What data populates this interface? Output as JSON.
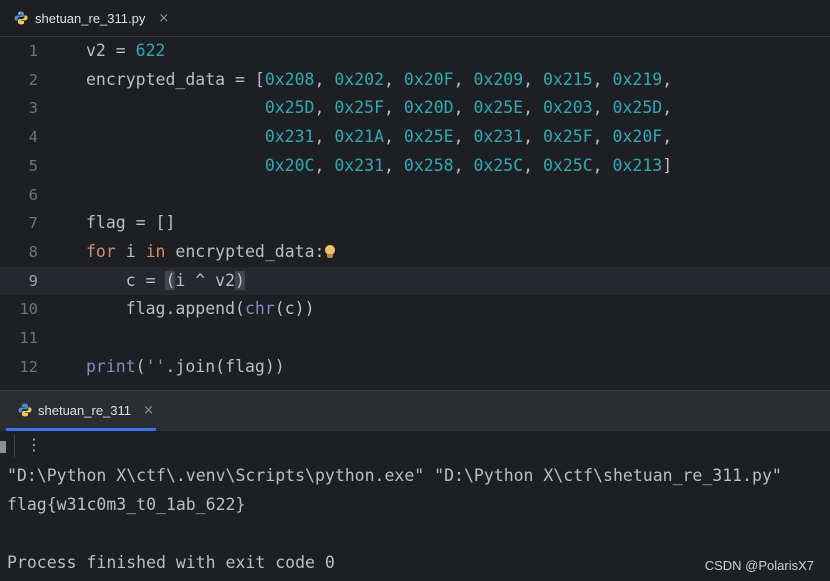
{
  "editor_tab": {
    "label": "shetuan_re_311.py",
    "close": "×",
    "icon": "python-icon"
  },
  "lines": [
    {
      "n": "1",
      "parts": [
        {
          "t": "v2 = ",
          "c": ""
        },
        {
          "t": "622",
          "c": "num"
        }
      ]
    },
    {
      "n": "2",
      "parts": [
        {
          "t": "encrypted_data = [",
          "c": ""
        },
        {
          "t": "0x208",
          "c": "num"
        },
        {
          "t": ", ",
          "c": ""
        },
        {
          "t": "0x202",
          "c": "num"
        },
        {
          "t": ", ",
          "c": ""
        },
        {
          "t": "0x20F",
          "c": "num"
        },
        {
          "t": ", ",
          "c": ""
        },
        {
          "t": "0x209",
          "c": "num"
        },
        {
          "t": ", ",
          "c": ""
        },
        {
          "t": "0x215",
          "c": "num"
        },
        {
          "t": ", ",
          "c": ""
        },
        {
          "t": "0x219",
          "c": "num"
        },
        {
          "t": ",",
          "c": ""
        }
      ]
    },
    {
      "n": "3",
      "parts": [
        {
          "t": "                  ",
          "c": ""
        },
        {
          "t": "0x25D",
          "c": "num"
        },
        {
          "t": ", ",
          "c": ""
        },
        {
          "t": "0x25F",
          "c": "num"
        },
        {
          "t": ", ",
          "c": ""
        },
        {
          "t": "0x20D",
          "c": "num"
        },
        {
          "t": ", ",
          "c": ""
        },
        {
          "t": "0x25E",
          "c": "num"
        },
        {
          "t": ", ",
          "c": ""
        },
        {
          "t": "0x203",
          "c": "num"
        },
        {
          "t": ", ",
          "c": ""
        },
        {
          "t": "0x25D",
          "c": "num"
        },
        {
          "t": ",",
          "c": ""
        }
      ]
    },
    {
      "n": "4",
      "parts": [
        {
          "t": "                  ",
          "c": ""
        },
        {
          "t": "0x231",
          "c": "num"
        },
        {
          "t": ", ",
          "c": ""
        },
        {
          "t": "0x21A",
          "c": "num"
        },
        {
          "t": ", ",
          "c": ""
        },
        {
          "t": "0x25E",
          "c": "num"
        },
        {
          "t": ", ",
          "c": ""
        },
        {
          "t": "0x231",
          "c": "num"
        },
        {
          "t": ", ",
          "c": ""
        },
        {
          "t": "0x25F",
          "c": "num"
        },
        {
          "t": ", ",
          "c": ""
        },
        {
          "t": "0x20F",
          "c": "num"
        },
        {
          "t": ",",
          "c": ""
        }
      ]
    },
    {
      "n": "5",
      "parts": [
        {
          "t": "                  ",
          "c": ""
        },
        {
          "t": "0x20C",
          "c": "num"
        },
        {
          "t": ", ",
          "c": ""
        },
        {
          "t": "0x231",
          "c": "num"
        },
        {
          "t": ", ",
          "c": ""
        },
        {
          "t": "0x258",
          "c": "num"
        },
        {
          "t": ", ",
          "c": ""
        },
        {
          "t": "0x25C",
          "c": "num"
        },
        {
          "t": ", ",
          "c": ""
        },
        {
          "t": "0x25C",
          "c": "num"
        },
        {
          "t": ", ",
          "c": ""
        },
        {
          "t": "0x213",
          "c": "num"
        },
        {
          "t": "]",
          "c": ""
        }
      ]
    },
    {
      "n": "6",
      "parts": []
    },
    {
      "n": "7",
      "parts": [
        {
          "t": "flag = []",
          "c": ""
        }
      ]
    },
    {
      "n": "8",
      "parts": [
        {
          "t": "for",
          "c": "kw"
        },
        {
          "t": " i ",
          "c": ""
        },
        {
          "t": "in",
          "c": "kw"
        },
        {
          "t": " encrypted_data:",
          "c": ""
        },
        {
          "t": "",
          "c": "bulb"
        }
      ]
    },
    {
      "n": "9",
      "active": true,
      "parts": [
        {
          "t": "    c = ",
          "c": ""
        },
        {
          "t": "(",
          "c": "paren-hl"
        },
        {
          "t": "i ^ v2",
          "c": ""
        },
        {
          "t": ")",
          "c": "paren-hl"
        }
      ]
    },
    {
      "n": "10",
      "parts": [
        {
          "t": "    flag.append(",
          "c": ""
        },
        {
          "t": "chr",
          "c": "bi"
        },
        {
          "t": "(c))",
          "c": ""
        }
      ]
    },
    {
      "n": "11",
      "parts": []
    },
    {
      "n": "12",
      "parts": [
        {
          "t": "print",
          "c": "bi"
        },
        {
          "t": "(",
          "c": ""
        },
        {
          "t": "''",
          "c": "str"
        },
        {
          "t": ".join(flag))",
          "c": ""
        }
      ]
    }
  ],
  "run_tab": {
    "label": "shetuan_re_311",
    "close": "×",
    "icon": "python-icon"
  },
  "toolbar": {
    "more": "⋮"
  },
  "console": [
    "\"D:\\Python X\\ctf\\.venv\\Scripts\\python.exe\" \"D:\\Python X\\ctf\\shetuan_re_311.py\"",
    "flag{w31c0m3_t0_1ab_622}",
    "",
    "Process finished with exit code 0"
  ],
  "watermark": "CSDN @PolarisX7"
}
